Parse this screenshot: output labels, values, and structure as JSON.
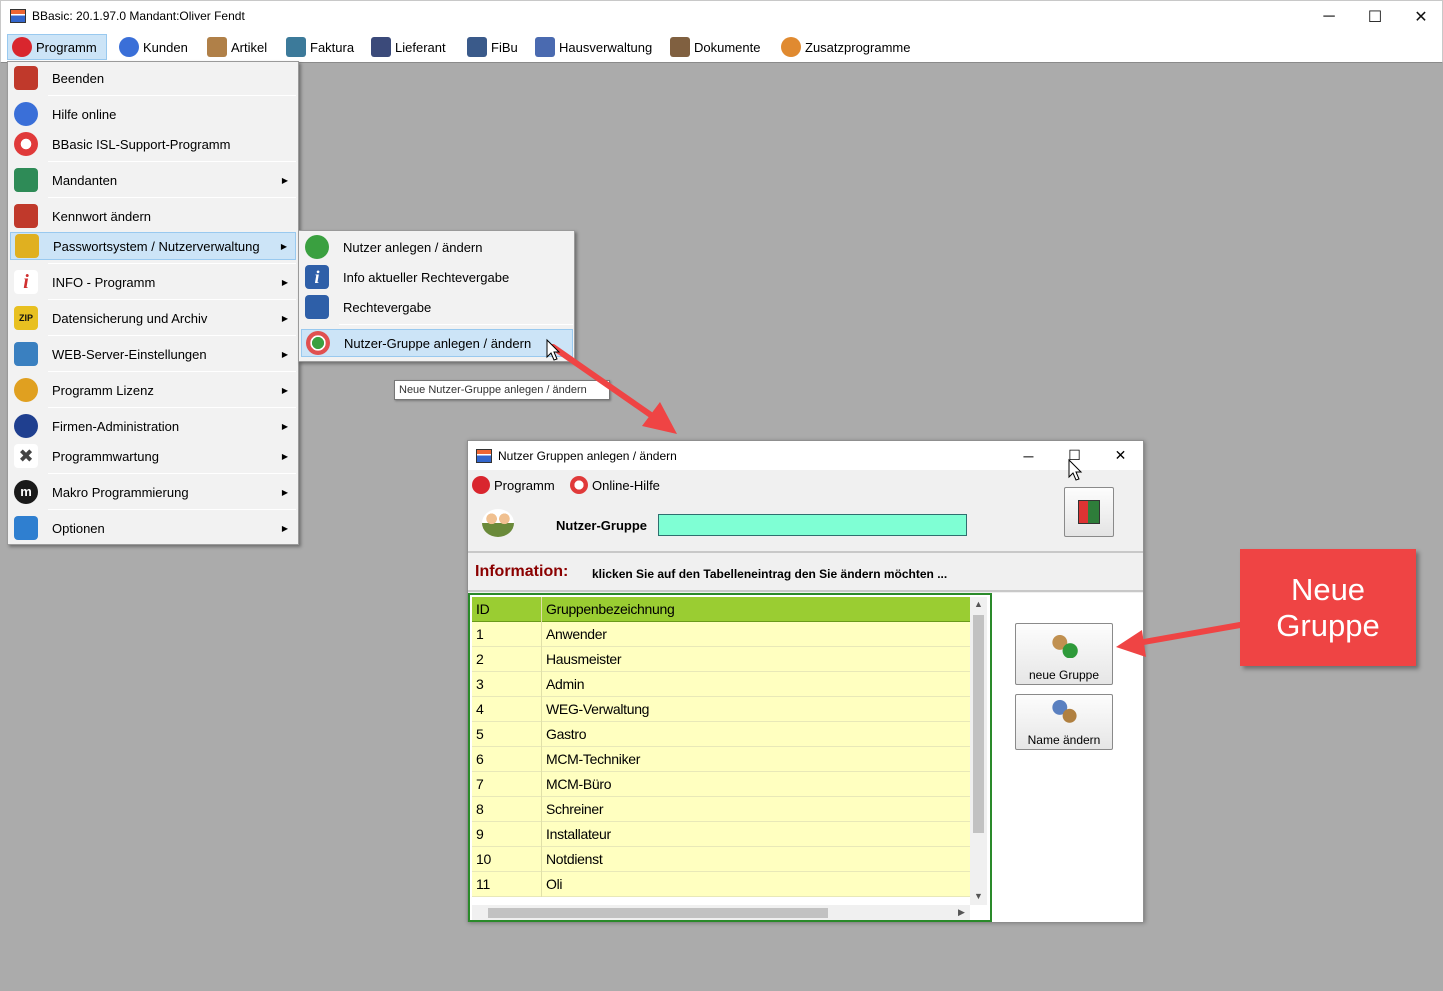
{
  "window": {
    "title": "BBasic: 20.1.97.0 Mandant:Oliver Fendt",
    "minimize": "─",
    "maximize": "☐",
    "close": "✕"
  },
  "menubar": [
    {
      "label": "Programm",
      "color": "#d9262e"
    },
    {
      "label": "Kunden",
      "color": "#3a6fd8"
    },
    {
      "label": "Artikel",
      "color": "#b08048"
    },
    {
      "label": "Faktura",
      "color": "#3c7a9a"
    },
    {
      "label": "Lieferant",
      "color": "#3b4a7a"
    },
    {
      "label": "FiBu",
      "color": "#3a5a8a"
    },
    {
      "label": "Hausverwaltung",
      "color": "#4a6ab0"
    },
    {
      "label": "Dokumente",
      "color": "#806040"
    },
    {
      "label": "Zusatzprogramme",
      "color": "#e08a30"
    }
  ],
  "program_menu": {
    "items": [
      {
        "label": "Beenden",
        "icon": "exit-icon",
        "color": "#c0392b",
        "arrow": false
      },
      {
        "label": "Hilfe online",
        "icon": "globe-icon",
        "color": "#3a6fd8",
        "arrow": false
      },
      {
        "label": "BBasic ISL-Support-Programm",
        "icon": "lifebuoy-icon",
        "color": "#e03a3a",
        "arrow": false
      },
      {
        "label": "Mandanten",
        "icon": "chart-icon",
        "color": "#2e8b57",
        "arrow": true
      },
      {
        "label": "Kennwort ändern",
        "icon": "lock-icon",
        "color": "#c0392b",
        "arrow": false
      },
      {
        "label": "Passwortsystem / Nutzerverwaltung",
        "icon": "users-key-icon",
        "color": "#e0b020",
        "arrow": true
      },
      {
        "label": "INFO - Programm",
        "icon": "info-icon",
        "color": "#d03030",
        "arrow": true
      },
      {
        "label": "Datensicherung und Archiv",
        "icon": "zip-icon",
        "color": "#2a2a2a",
        "arrow": true
      },
      {
        "label": "WEB-Server-Einstellungen",
        "icon": "network-icon",
        "color": "#3a80c0",
        "arrow": true
      },
      {
        "label": "Programm Lizenz",
        "icon": "key-icon",
        "color": "#e0a020",
        "arrow": true
      },
      {
        "label": "Firmen-Administration",
        "icon": "gear-user-icon",
        "color": "#1f3f8f",
        "arrow": true
      },
      {
        "label": "Programmwartung",
        "icon": "tools-icon",
        "color": "#444444",
        "arrow": true
      },
      {
        "label": "Makro Programmierung",
        "icon": "macro-icon",
        "color": "#1a1a1a",
        "arrow": true
      },
      {
        "label": "Optionen",
        "icon": "options-icon",
        "color": "#2f7fd0",
        "arrow": true
      }
    ]
  },
  "submenu": {
    "items": [
      {
        "label": "Nutzer anlegen / ändern",
        "icon": "user-add-icon",
        "color": "#3aa040"
      },
      {
        "label": "Info aktueller Rechtevergabe",
        "icon": "info-i-icon",
        "color": "#2e5fa8"
      },
      {
        "label": "Rechtevergabe",
        "icon": "user-rights-icon",
        "color": "#2e5fa8"
      },
      {
        "label": "Nutzer-Gruppe anlegen / ändern",
        "icon": "group-add-icon",
        "color": "#3aa040"
      }
    ],
    "tooltip": "Neue Nutzer-Gruppe anlegen / ändern"
  },
  "dialog": {
    "title": "Nutzer Gruppen anlegen /  ändern",
    "menu_programm": "Programm",
    "menu_hilfe": "Online-Hilfe",
    "field_label": "Nutzer-Gruppe",
    "field_value": "",
    "info_label": "Information:",
    "info_text": "klicken Sie auf den Tabelleneintrag den Sie ändern möchten ...",
    "table": {
      "headers": [
        "ID",
        "Gruppenbezeichnung"
      ],
      "rows": [
        [
          "1",
          "Anwender"
        ],
        [
          "2",
          "Hausmeister"
        ],
        [
          "3",
          "Admin"
        ],
        [
          "4",
          "WEG-Verwaltung"
        ],
        [
          "5",
          "Gastro"
        ],
        [
          "6",
          "MCM-Techniker"
        ],
        [
          "7",
          "MCM-Büro"
        ],
        [
          "8",
          "Schreiner"
        ],
        [
          "9",
          "Installateur"
        ],
        [
          "10",
          "Notdienst"
        ],
        [
          "11",
          "Oli"
        ]
      ]
    },
    "buttons": {
      "new_group": "neue Gruppe",
      "rename": "Name ändern"
    }
  },
  "annotation": {
    "callout": "Neue Gruppe",
    "color": "#ef4444"
  }
}
